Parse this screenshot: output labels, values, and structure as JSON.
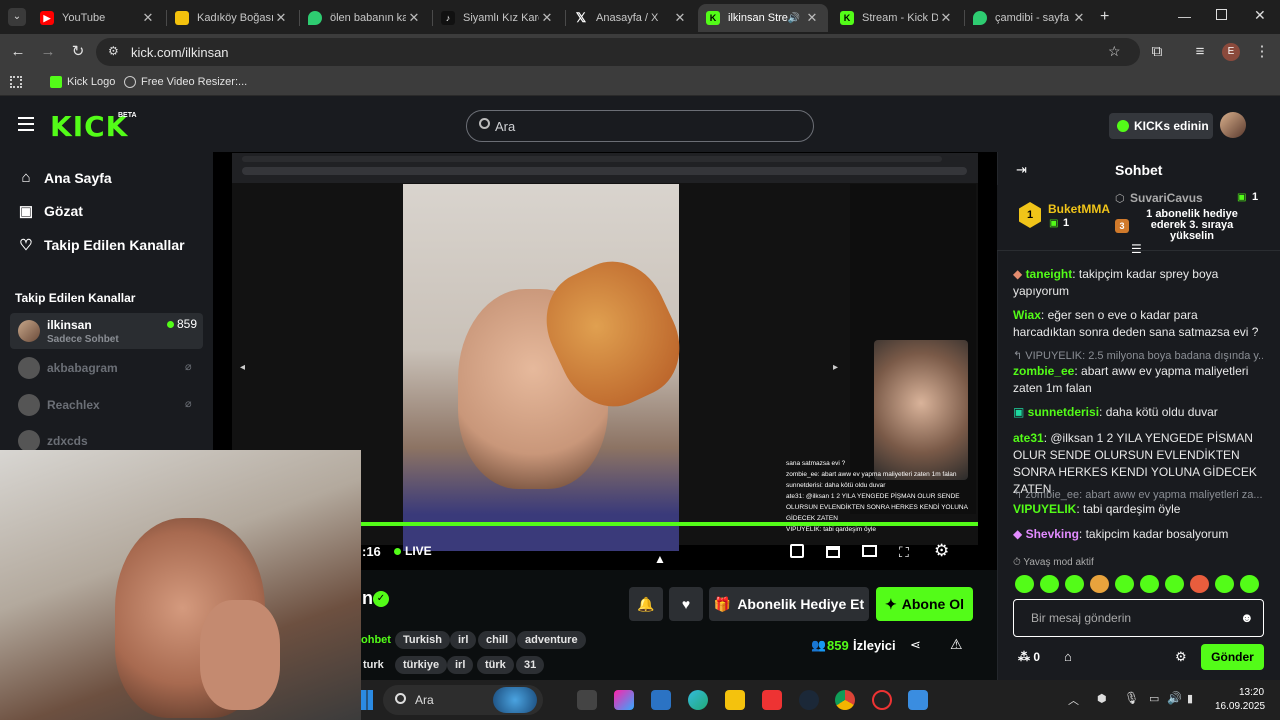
{
  "browser": {
    "tabs": [
      {
        "title": "YouTube",
        "icon": "youtube-icon",
        "color": "#ff0000"
      },
      {
        "title": "Kadıköy Boğası (",
        "icon": "stack-icon",
        "color": "#f4c20d"
      },
      {
        "title": "ölen babanın kay",
        "icon": "drop-icon",
        "color": "#2ecc71"
      },
      {
        "title": "Siyamlı Kız Karde",
        "icon": "tiktok-icon",
        "color": "#111111"
      },
      {
        "title": "Anasayfa / X",
        "icon": "x-icon",
        "color": "#111111"
      },
      {
        "title": "ilkinsan Strea",
        "icon": "kick-icon",
        "color": "#53fc18"
      },
      {
        "title": "Stream - Kick Da",
        "icon": "kick-icon",
        "color": "#53fc18"
      },
      {
        "title": "çamdibi - sayfa",
        "icon": "drop-icon",
        "color": "#2ecc71"
      }
    ],
    "url": "kick.com/ilkinsan",
    "bookmarks": [
      "Kick Logo",
      "Free Video Resizer:..."
    ],
    "profile_initial": "E"
  },
  "kick": {
    "logo": "KICK",
    "beta": "BETA",
    "search_placeholder": "Ara",
    "kicks_button": "KICKs edinin"
  },
  "sidebar": {
    "nav": [
      "Ana Sayfa",
      "Gözat",
      "Takip Edilen Kanallar"
    ],
    "section_title": "Takip Edilen Kanallar",
    "channels": [
      {
        "name": "ilkinsan",
        "sub": "Sadece Sohbet",
        "viewers": "859",
        "live": true
      },
      {
        "name": "akbabagram",
        "live": false
      },
      {
        "name": "Reachlex",
        "live": false
      },
      {
        "name": "zdxcds",
        "live": false
      }
    ]
  },
  "player": {
    "time": ":16",
    "live_label": "LIVE",
    "progress": 1.0,
    "overlay_chat": [
      "sana satmazsa evi ?",
      "zombie_ee: abart aww ev yapma maliyetleri zaten 1m falan",
      "sunnetderisi: daha kötü oldu duvar",
      "ate31: @ilksan 1 2 YILA YENGEDE PİŞMAN OLUR SENDE OLURSUN EVLENDİKTEN SONRA HERKES KENDİ YOLUNA GİDECEK ZATEN",
      "VIPUYELIK: tabi qardeşim öyle"
    ]
  },
  "stream_info": {
    "title_fragment": "n",
    "tags_row1": [
      "ohbet",
      "Turkish",
      "irl",
      "chill",
      "adventure"
    ],
    "tags_row2": [
      "turk",
      "türkiye",
      "irl",
      "türk",
      "31"
    ],
    "gift_button": "Abonelik Hediye Et",
    "subscribe_button": "Abone Ol",
    "viewer_count": "859",
    "viewer_label": "İzleyici"
  },
  "chat": {
    "header": "Sohbet",
    "pinned": {
      "rank1_user": "BuketMMA",
      "rank1_count": "1",
      "rank2_user": "SuvariCavus",
      "rank2_count": "1",
      "message": "1 abonelik hediye ederek 3. sıraya yükselin"
    },
    "messages": [
      {
        "user": "taneight",
        "color": "#53fc18",
        "text": "takipçim kadar sprey boya yapıyorum"
      },
      {
        "user": "Wiax",
        "color": "#53fc18",
        "text": "eğer sen o eve o kadar para harcadıktan sonra deden sana satmazsa evi ?"
      },
      {
        "user": "zombie_ee",
        "color": "#53fc18",
        "text": "abart aww ev yapma maliyetleri zaten 1m falan",
        "reply": "VIPUYELIK: 2.5 milyona boya badana dışında y..."
      },
      {
        "user": "sunnetderisi",
        "color": "#53fc18",
        "text": "daha kötü oldu duvar"
      },
      {
        "user": "ate31",
        "color": "#53fc18",
        "text": "@ilksan 1 2 YILA YENGEDE PİSMAN OLUR SENDE OLURSUN EVLENDİKTEN SONRA HERKES KENDI YOLUNA GİDECEK ZATEN"
      },
      {
        "user": "VIPUYELIK",
        "color": "#53fc18",
        "text": "tabi qardeşim öyle",
        "reply": "zombie_ee: abart aww ev yapma maliyetleri za..."
      },
      {
        "user": "Shevking",
        "color": "#e28bff",
        "text": "takipcim kadar bosalyorum"
      }
    ],
    "slow_mode": "Yavaş mod aktif",
    "input_placeholder": "Bir mesaj gönderin",
    "kicks_count": "0",
    "send_button": "Gönder"
  },
  "taskbar": {
    "search": "Ara",
    "time": "13:20",
    "date": "16.09.2025"
  }
}
